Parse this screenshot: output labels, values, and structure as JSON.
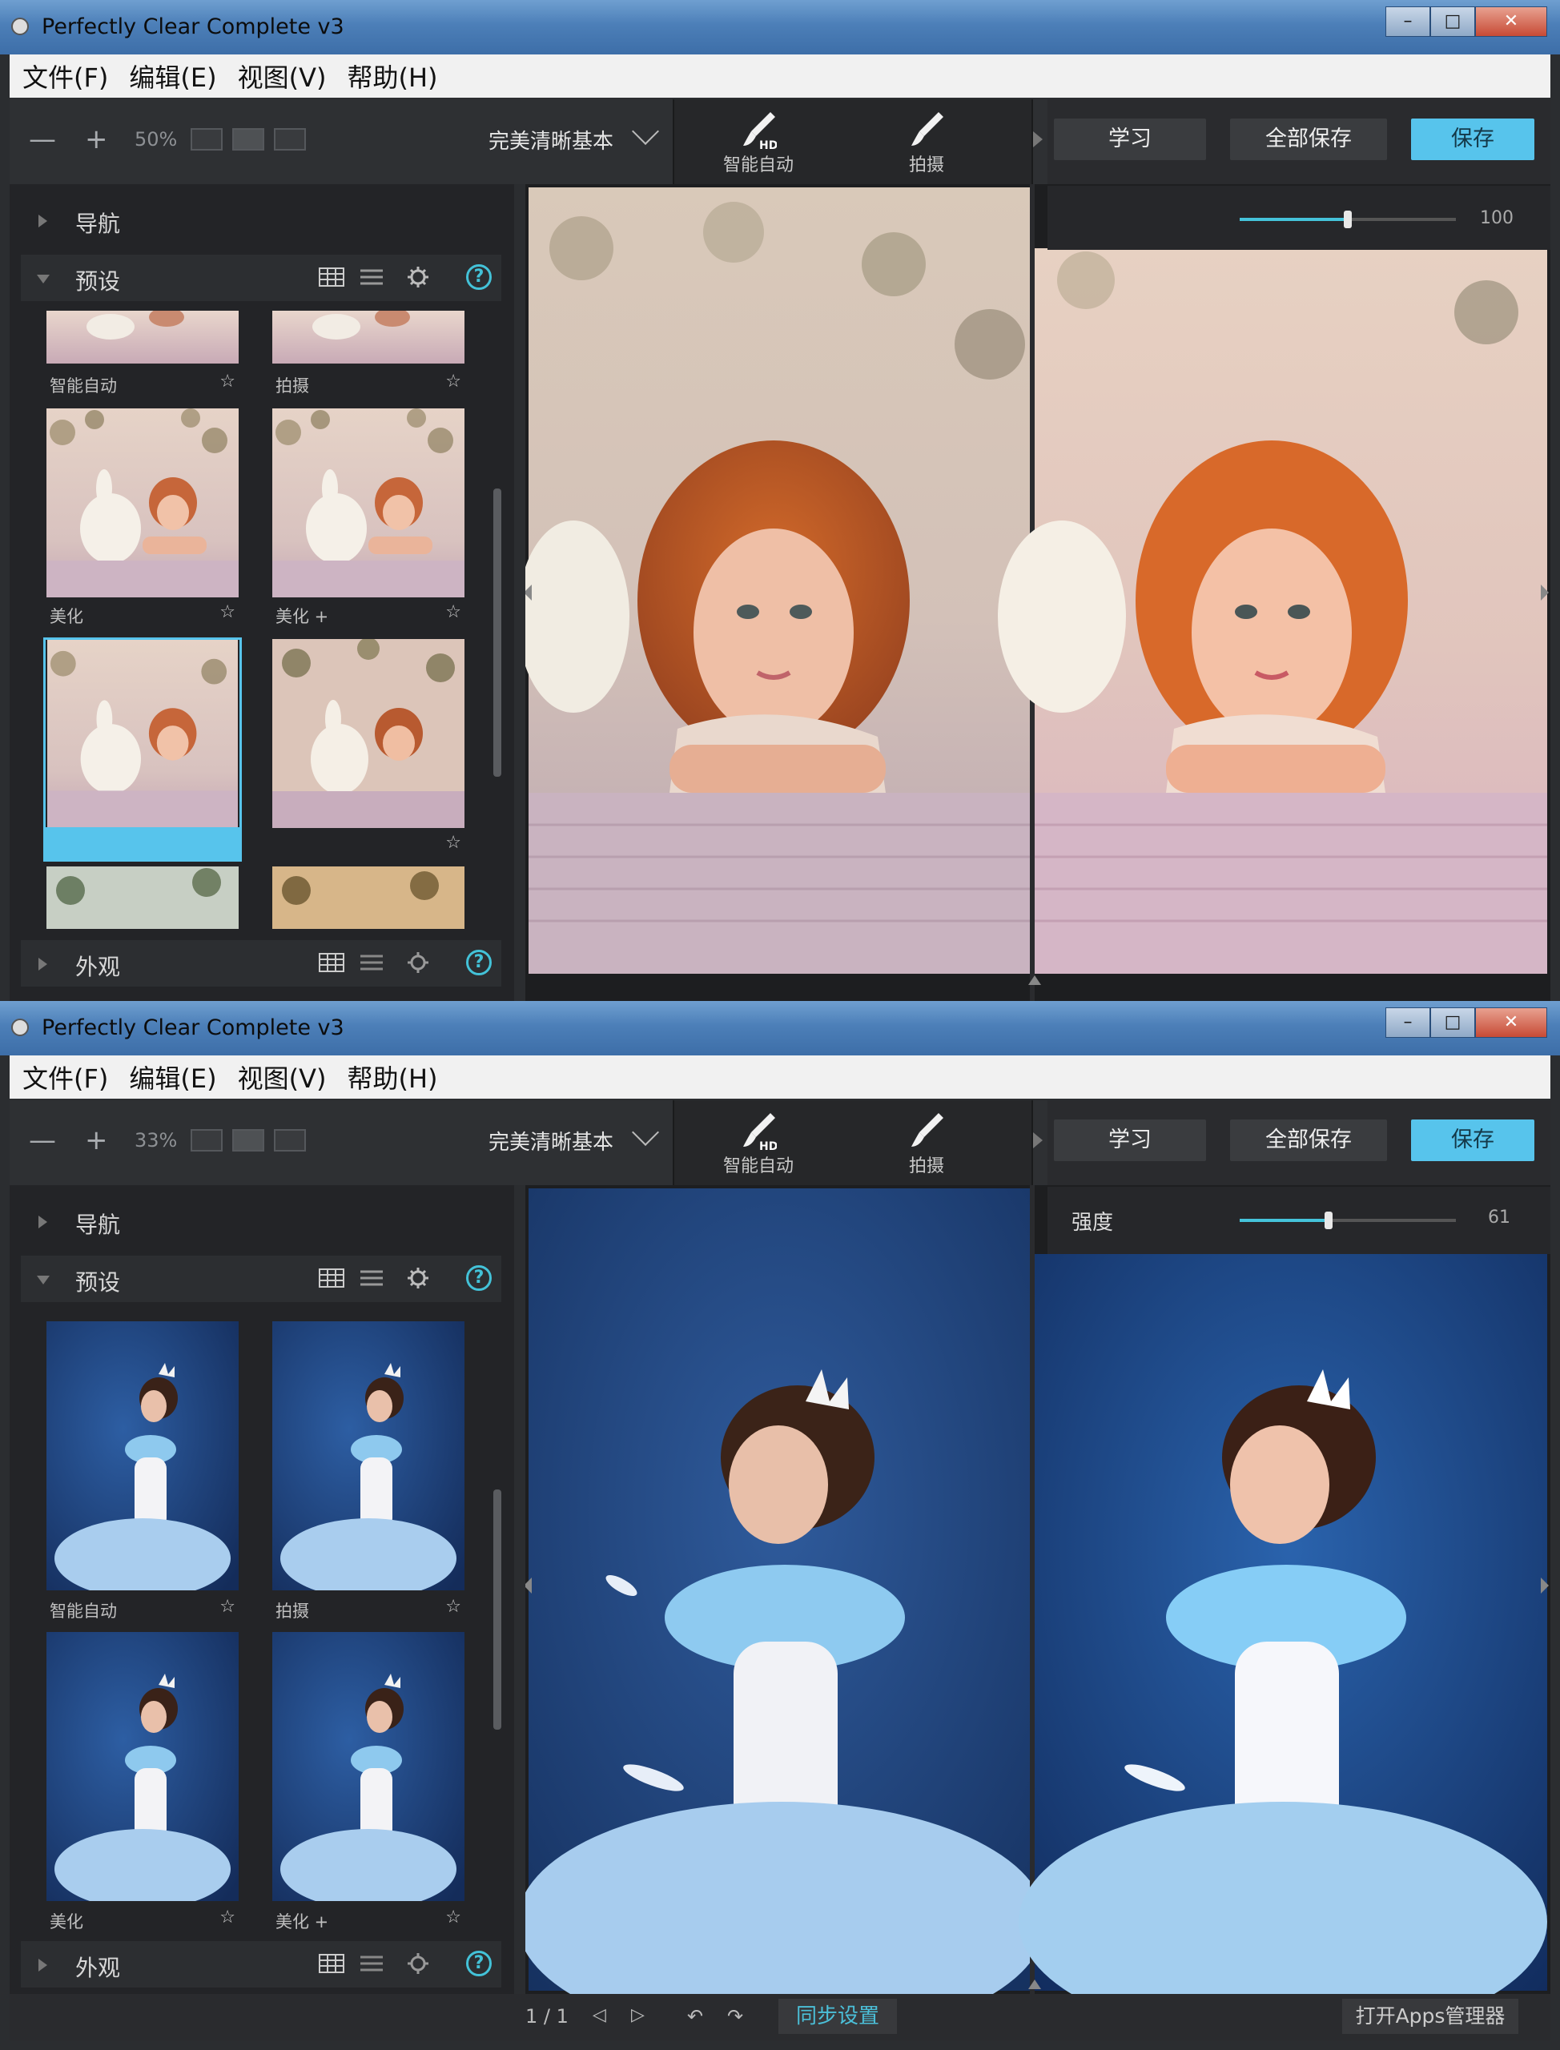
{
  "app": {
    "title": "Perfectly Clear Complete v3"
  },
  "window_buttons": {
    "minimize": "–",
    "maximize": "□",
    "close": "✕"
  },
  "menu": [
    "文件(F)",
    "编辑(E)",
    "视图(V)",
    "帮助(H)"
  ],
  "screens": [
    {
      "zoom": "50%",
      "preset_name": "完美清晰基本",
      "tools": [
        {
          "label": "智能自动",
          "badge": "HD",
          "icon": "brush-icon"
        },
        {
          "label": "拍摄",
          "icon": "brush-icon"
        }
      ],
      "actions": {
        "learn": "学习",
        "save_all": "全部保存",
        "save": "保存"
      },
      "panels": {
        "navigation": "导航",
        "presets": "预设",
        "appearance": "外观"
      },
      "strength": {
        "label": "",
        "value": "100",
        "level": 0.5
      },
      "thumbnails": [
        {
          "caption": "智能自动",
          "star": "☆"
        },
        {
          "caption": "拍摄",
          "star": "☆"
        },
        {
          "caption": "美化",
          "star": "☆"
        },
        {
          "caption": "美化 +",
          "star": "☆"
        },
        {
          "caption": "",
          "star": ""
        },
        {
          "caption": "",
          "star": "☆"
        }
      ]
    },
    {
      "zoom": "33%",
      "preset_name": "完美清晰基本",
      "tools": [
        {
          "label": "智能自动",
          "badge": "HD",
          "icon": "brush-icon"
        },
        {
          "label": "拍摄",
          "icon": "brush-icon"
        }
      ],
      "actions": {
        "learn": "学习",
        "save_all": "全部保存",
        "save": "保存"
      },
      "panels": {
        "navigation": "导航",
        "presets": "预设",
        "appearance": "外观"
      },
      "strength": {
        "label": "强度",
        "value": "61",
        "level": 0.41
      },
      "thumbnails": [
        {
          "caption": "智能自动",
          "star": "☆"
        },
        {
          "caption": "拍摄",
          "star": "☆"
        },
        {
          "caption": "美化",
          "star": "☆"
        },
        {
          "caption": "美化 +",
          "star": "☆"
        }
      ],
      "status": {
        "page": "1 / 1",
        "sync": "同步设置",
        "apps": "打开Apps管理器"
      }
    }
  ],
  "colors": {
    "accent": "#57c4ec",
    "titlebar": "#4c7fb8",
    "panel": "#232427"
  }
}
